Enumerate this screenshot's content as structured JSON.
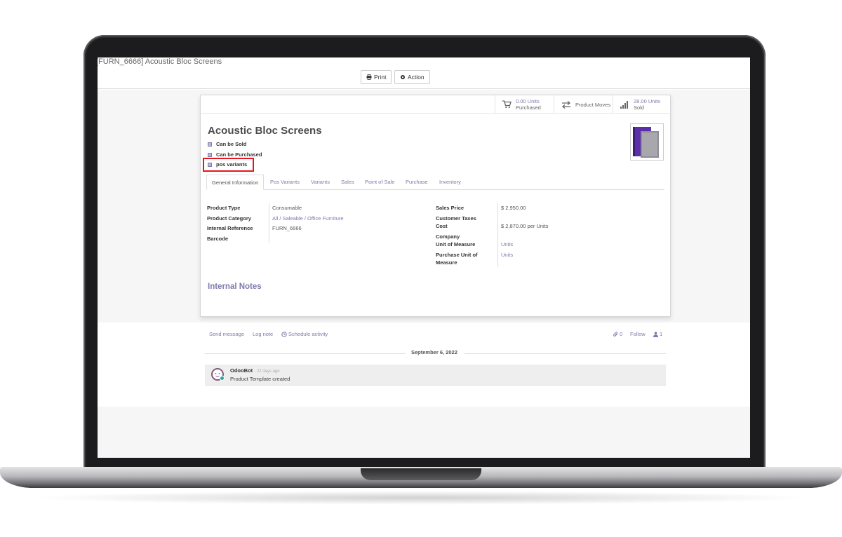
{
  "breadcrumb": "[FURN_6666] Acoustic Bloc Screens",
  "toolbar": {
    "print_label": "Print",
    "action_label": "Action"
  },
  "smart_buttons": [
    {
      "value": "0.00 Units",
      "label": "Purchased",
      "icon": "cart-icon"
    },
    {
      "value": "",
      "label": "Product Moves",
      "icon": "exchange-icon"
    },
    {
      "value": "28.00 Units",
      "label": "Sold",
      "icon": "bar-chart-icon"
    }
  ],
  "product": {
    "name": "Acoustic Bloc Screens",
    "can_be_sold": "Can be Sold",
    "can_be_purchased": "Can be Purchased",
    "pos_variants": "pos variants"
  },
  "tabs": [
    "General Information",
    "Pos Variants",
    "Variants",
    "Sales",
    "Point of Sale",
    "Purchase",
    "Inventory"
  ],
  "general": {
    "product_type_label": "Product Type",
    "product_type": "Consumable",
    "category_label": "Product Category",
    "category": "All / Saleable / Office Furniture",
    "internal_ref_label": "Internal Reference",
    "internal_ref": "FURN_6666",
    "barcode_label": "Barcode",
    "sales_price_label": "Sales Price",
    "sales_price": "$ 2,950.00",
    "customer_taxes_label": "Customer Taxes",
    "cost_label": "Cost",
    "cost": "$ 2,870.00 per Units",
    "company_label": "Company",
    "uom_label": "Unit of Measure",
    "uom": "Units",
    "purchase_uom_label_1": "Purchase Unit of",
    "purchase_uom_label_2": "Measure",
    "purchase_uom": "Units"
  },
  "internal_notes": "Internal Notes",
  "chatter": {
    "send_message": "Send message",
    "log_note": "Log note",
    "schedule_activity": "Schedule activity",
    "attachments": "0",
    "follow": "Follow",
    "followers": "1",
    "date": "September 6, 2022",
    "author": "OdooBot",
    "time_ago": "- 22 days ago",
    "message": "Product Template created"
  },
  "colors": {
    "accent": "#7c7bad",
    "highlight": "#e4171f",
    "brand": "#875a7b"
  }
}
